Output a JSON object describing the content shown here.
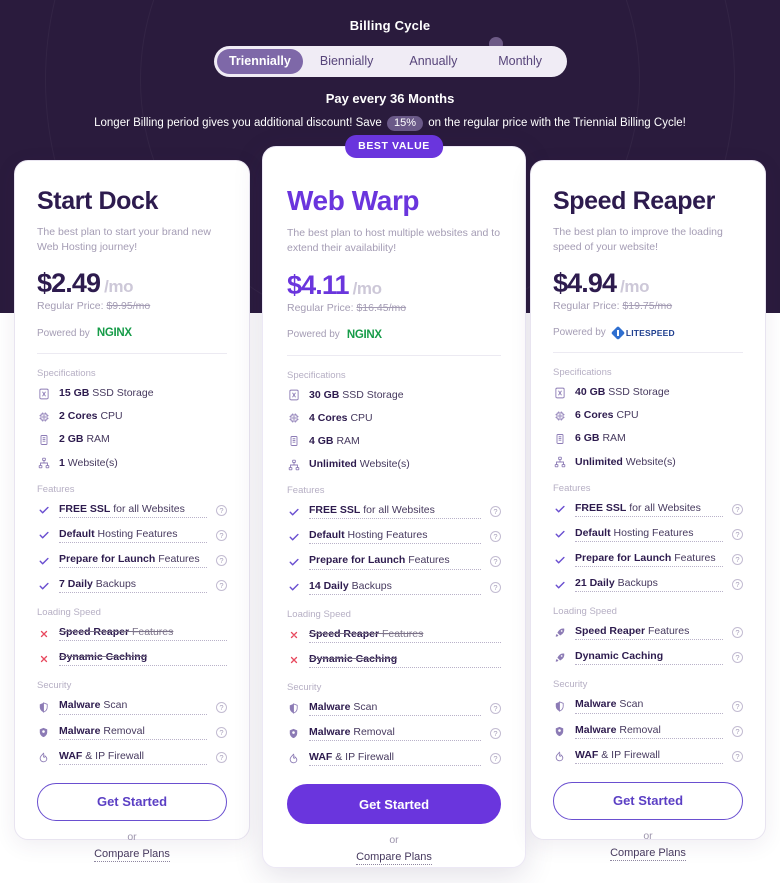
{
  "hero": {
    "billing_title": "Billing Cycle",
    "cycles": [
      {
        "label": "Triennially",
        "active": true
      },
      {
        "label": "Biennially",
        "active": false
      },
      {
        "label": "Annually",
        "active": false
      },
      {
        "label": "Monthly",
        "active": false
      }
    ],
    "pay_every": "Pay every 36 Months",
    "discount_prefix": "Longer Billing period gives you additional discount! Save",
    "discount_badge": "15%",
    "discount_suffix": "on the regular price with the Triennial Billing Cycle!",
    "bg_color": "#2a1b3d",
    "active_pill_color": "#7e68a8"
  },
  "labels": {
    "specifications": "Specifications",
    "features": "Features",
    "loading_speed": "Loading Speed",
    "security": "Security",
    "powered_by": "Powered by",
    "regular_price_prefix": "Regular Price:",
    "or": "or",
    "compare_plans": "Compare Plans",
    "get_started": "Get Started",
    "best_value": "BEST VALUE",
    "help": "?"
  },
  "accent": {
    "purple": "#6a35dd",
    "check": "#6a4fd0",
    "cross": "#e84a5f",
    "nginx_green": "#179c49",
    "litespeed_blue": "#1f3f8f"
  },
  "plans": [
    {
      "name": "Start Dock",
      "desc": "The best plan to start your brand new Web Hosting journey!",
      "price": "$2.49",
      "per": "/mo",
      "regular_price": "$9.95/mo",
      "powered_logo": "nginx-logo",
      "powered_text": "NGINX",
      "featured": false,
      "specs": [
        {
          "strong": "15 GB",
          "rest": "SSD Storage",
          "icon": "storage-icon"
        },
        {
          "strong": "2 Cores",
          "rest": "CPU",
          "icon": "cpu-icon"
        },
        {
          "strong": "2 GB",
          "rest": "RAM",
          "icon": "ram-icon"
        },
        {
          "strong": "1",
          "rest": "Website(s)",
          "icon": "sitemap-icon"
        }
      ],
      "features": [
        {
          "strong": "FREE SSL",
          "rest": "for all Websites",
          "state": "included",
          "icon": "check-icon",
          "help": true
        },
        {
          "strong": "Default",
          "rest": "Hosting Features",
          "state": "included",
          "icon": "check-icon",
          "help": true
        },
        {
          "strong": "Prepare for Launch",
          "rest": "Features",
          "state": "included",
          "icon": "check-icon",
          "help": true
        },
        {
          "strong": "7 Daily",
          "rest": "Backups",
          "state": "included",
          "icon": "check-icon",
          "help": true
        }
      ],
      "loading_speed": [
        {
          "strong": "Speed Reaper",
          "rest": "Features",
          "state": "excluded",
          "icon": "cross-icon",
          "help": false
        },
        {
          "strong": "Dynamic Caching",
          "rest": "",
          "state": "excluded",
          "icon": "cross-icon",
          "help": false
        }
      ],
      "security": [
        {
          "strong": "Malware",
          "rest": "Scan",
          "state": "included",
          "icon": "shield-half-icon",
          "help": true
        },
        {
          "strong": "Malware",
          "rest": "Removal",
          "state": "included",
          "icon": "shield-check-icon",
          "help": true
        },
        {
          "strong": "WAF",
          "rest": "& IP Firewall",
          "state": "included",
          "icon": "firewall-icon",
          "help": true
        }
      ]
    },
    {
      "name": "Web Warp",
      "desc": "The best plan to host multiple websites and to extend their availability!",
      "price": "$4.11",
      "per": "/mo",
      "regular_price": "$16.45/mo",
      "powered_logo": "nginx-logo",
      "powered_text": "NGINX",
      "featured": true,
      "specs": [
        {
          "strong": "30 GB",
          "rest": "SSD Storage",
          "icon": "storage-icon"
        },
        {
          "strong": "4 Cores",
          "rest": "CPU",
          "icon": "cpu-icon"
        },
        {
          "strong": "4 GB",
          "rest": "RAM",
          "icon": "ram-icon"
        },
        {
          "strong": "Unlimited",
          "rest": "Website(s)",
          "icon": "sitemap-icon"
        }
      ],
      "features": [
        {
          "strong": "FREE SSL",
          "rest": "for all Websites",
          "state": "included",
          "icon": "check-icon",
          "help": true
        },
        {
          "strong": "Default",
          "rest": "Hosting Features",
          "state": "included",
          "icon": "check-icon",
          "help": true
        },
        {
          "strong": "Prepare for Launch",
          "rest": "Features",
          "state": "included",
          "icon": "check-icon",
          "help": true
        },
        {
          "strong": "14 Daily",
          "rest": "Backups",
          "state": "included",
          "icon": "check-icon",
          "help": true
        }
      ],
      "loading_speed": [
        {
          "strong": "Speed Reaper",
          "rest": "Features",
          "state": "excluded",
          "icon": "cross-icon",
          "help": false
        },
        {
          "strong": "Dynamic Caching",
          "rest": "",
          "state": "excluded",
          "icon": "cross-icon",
          "help": false
        }
      ],
      "security": [
        {
          "strong": "Malware",
          "rest": "Scan",
          "state": "included",
          "icon": "shield-half-icon",
          "help": true
        },
        {
          "strong": "Malware",
          "rest": "Removal",
          "state": "included",
          "icon": "shield-check-icon",
          "help": true
        },
        {
          "strong": "WAF",
          "rest": "& IP Firewall",
          "state": "included",
          "icon": "firewall-icon",
          "help": true
        }
      ]
    },
    {
      "name": "Speed Reaper",
      "desc": "The best plan to improve the loading speed of your website!",
      "price": "$4.94",
      "per": "/mo",
      "regular_price": "$19.75/mo",
      "powered_logo": "litespeed-logo",
      "powered_text": "LITESPEED",
      "featured": false,
      "specs": [
        {
          "strong": "40 GB",
          "rest": "SSD Storage",
          "icon": "storage-icon"
        },
        {
          "strong": "6 Cores",
          "rest": "CPU",
          "icon": "cpu-icon"
        },
        {
          "strong": "6 GB",
          "rest": "RAM",
          "icon": "ram-icon"
        },
        {
          "strong": "Unlimited",
          "rest": "Website(s)",
          "icon": "sitemap-icon"
        }
      ],
      "features": [
        {
          "strong": "FREE SSL",
          "rest": "for all Websites",
          "state": "included",
          "icon": "check-icon",
          "help": true
        },
        {
          "strong": "Default",
          "rest": "Hosting Features",
          "state": "included",
          "icon": "check-icon",
          "help": true
        },
        {
          "strong": "Prepare for Launch",
          "rest": "Features",
          "state": "included",
          "icon": "check-icon",
          "help": true
        },
        {
          "strong": "21 Daily",
          "rest": "Backups",
          "state": "included",
          "icon": "check-icon",
          "help": true
        }
      ],
      "loading_speed": [
        {
          "strong": "Speed Reaper",
          "rest": "Features",
          "state": "included",
          "icon": "rocket-icon",
          "help": true
        },
        {
          "strong": "Dynamic Caching",
          "rest": "",
          "state": "included",
          "icon": "rocket-icon",
          "help": true
        }
      ],
      "security": [
        {
          "strong": "Malware",
          "rest": "Scan",
          "state": "included",
          "icon": "shield-half-icon",
          "help": true
        },
        {
          "strong": "Malware",
          "rest": "Removal",
          "state": "included",
          "icon": "shield-check-icon",
          "help": true
        },
        {
          "strong": "WAF",
          "rest": "& IP Firewall",
          "state": "included",
          "icon": "firewall-icon",
          "help": true
        }
      ]
    }
  ]
}
